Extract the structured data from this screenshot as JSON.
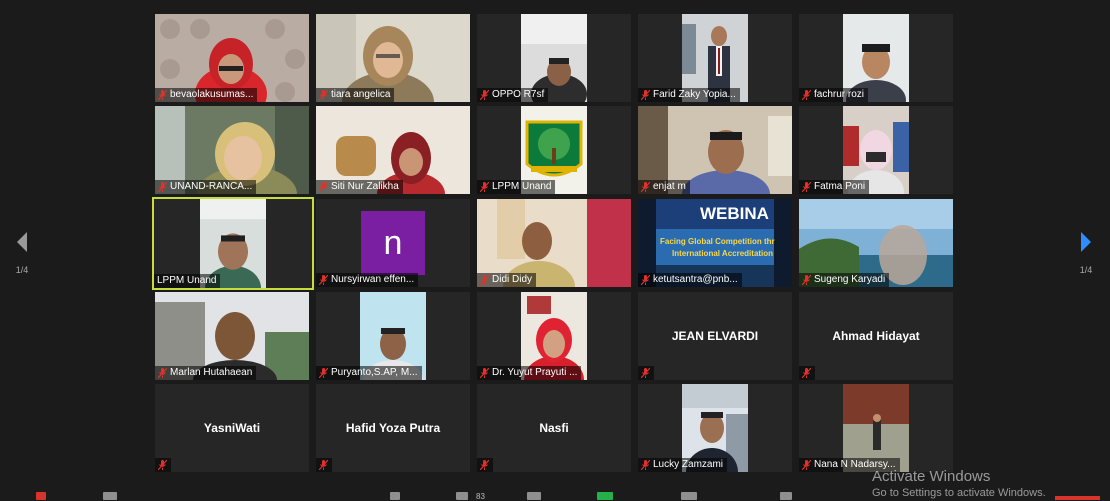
{
  "meeting": {
    "page_indicator_left": "1/4",
    "page_indicator_right": "1/4",
    "participant_count": "83"
  },
  "participants": [
    {
      "name": "bevaolakusumas..."
    },
    {
      "name": "tiara angelica"
    },
    {
      "name": "OPPO R7sf"
    },
    {
      "name": "Farid Zaky Yopia..."
    },
    {
      "name": "fachrur rozi"
    },
    {
      "name": "UNAND-RANCA..."
    },
    {
      "name": "Siti Nur Zalikha"
    },
    {
      "name": "LPPM Unand"
    },
    {
      "name": "enjat m"
    },
    {
      "name": "Fatma Poni"
    },
    {
      "name": "LPPM Unand"
    },
    {
      "name": "Nursyirwan effen..."
    },
    {
      "name": "Didi Didy"
    },
    {
      "name": "ketutsantra@pnb..."
    },
    {
      "name": "Sugeng Karyadi"
    },
    {
      "name": "Marlan Hutahaean"
    },
    {
      "name": "Puryanto,S.AP, M..."
    },
    {
      "name": "Dr. Yuyut Prayuti ..."
    },
    {
      "name": "JEAN ELVARDI"
    },
    {
      "name": "Ahmad Hidayat"
    },
    {
      "name": "YasniWati"
    },
    {
      "name": "Hafid Yoza Putra"
    },
    {
      "name": "Nasfi"
    },
    {
      "name": "Lucky Zamzami"
    },
    {
      "name": "Nana N Nadarsy..."
    }
  ],
  "avatar_letter": "n",
  "slide_text": {
    "line1": "WEBINA",
    "line2": "Facing Global Competition thr",
    "line3": "International Accreditation"
  },
  "watermark": {
    "title": "Activate Windows",
    "subtitle": "Go to Settings to activate Windows."
  },
  "colors": {
    "active_speaker_border": "#c8dc3c",
    "muted_icon": "#e0322a",
    "nav_arrow_right": "#2d8cff",
    "avatar_purple": "#7b1fa2"
  }
}
